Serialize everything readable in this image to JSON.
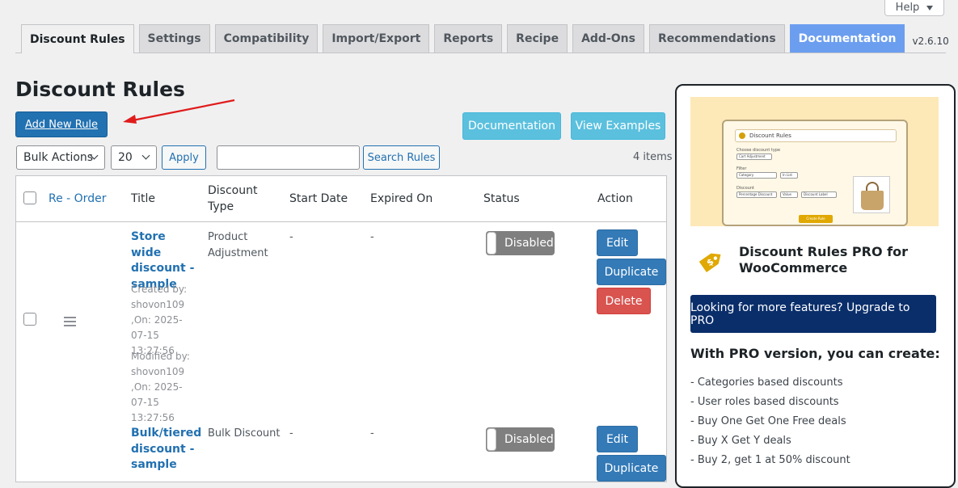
{
  "help": {
    "label": "Help"
  },
  "tabs": [
    {
      "label": "Discount Rules",
      "active": true
    },
    {
      "label": "Settings"
    },
    {
      "label": "Compatibility"
    },
    {
      "label": "Import/Export"
    },
    {
      "label": "Reports"
    },
    {
      "label": "Recipe"
    },
    {
      "label": "Add-Ons"
    },
    {
      "label": "Recommendations"
    },
    {
      "label": "Documentation",
      "highlight": true
    }
  ],
  "version": "v2.6.10",
  "page": {
    "title": "Discount Rules",
    "add_new_label": "Add New Rule",
    "documentation_label": "Documentation",
    "view_examples_label": "View Examples"
  },
  "filters": {
    "bulk_actions": "Bulk Actions",
    "per_page": "20",
    "apply_label": "Apply",
    "search_value": "",
    "search_label": "Search Rules",
    "items_count": "4 items"
  },
  "table": {
    "headers": {
      "reorder": "Re - Order",
      "title": "Title",
      "discount_type": "Discount Type",
      "start_date": "Start Date",
      "expired_on": "Expired On",
      "status": "Status",
      "action": "Action"
    },
    "rows": [
      {
        "title": "Store wide discount - sample",
        "created": "Created by: shovon109 ,On: 2025-07-15 13:27:56",
        "modified": "Modified by: shovon109 ,On: 2025-07-15 13:27:56",
        "discount_type": "Product Adjustment",
        "start_date": "-",
        "expired_on": "-",
        "status": "Disabled",
        "actions": {
          "edit": "Edit",
          "duplicate": "Duplicate",
          "delete": "Delete"
        }
      },
      {
        "title": "Bulk/tiered discount - sample",
        "discount_type": "Bulk Discount",
        "start_date": "-",
        "expired_on": "-",
        "status": "Disabled",
        "actions": {
          "edit": "Edit",
          "duplicate": "Duplicate"
        }
      }
    ]
  },
  "pro": {
    "mock": {
      "header": "Discount Rules",
      "choose_type": "Choose discount type",
      "type_value": "Cart Adjustment",
      "filter": "Filter",
      "filter_value": "Category",
      "filter_op": "In List",
      "discount": "Discount",
      "discount_value": "Percentage Discount",
      "value_label": "Value",
      "label_field": "Discount Label",
      "button": "Create Rule"
    },
    "title": "Discount Rules PRO for WooCommerce",
    "upgrade_label": "Looking for more features? Upgrade to PRO",
    "subtitle": "With PRO version, you can create:",
    "features": [
      "- Categories based discounts",
      "- User roles based discounts",
      "- Buy One Get One Free deals",
      "- Buy X Get Y deals",
      "- Buy 2, get 1 at 50% discount"
    ]
  },
  "colors": {
    "primary": "#2271b1",
    "info": "#5bc0de",
    "doc_tab": "#6c9ef0",
    "edit": "#337ab7",
    "delete": "#d9534f",
    "upgrade": "#0a2e6a"
  }
}
